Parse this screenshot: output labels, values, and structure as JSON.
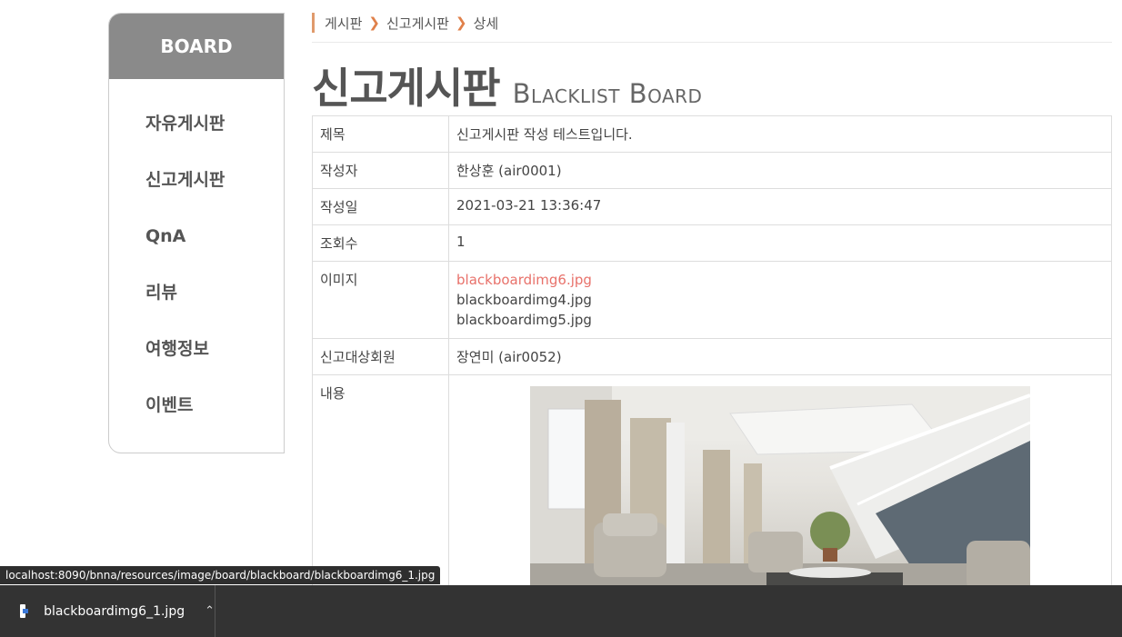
{
  "sidebar": {
    "title": "BOARD",
    "items": [
      "자유게시판",
      "신고게시판",
      "QnA",
      "리뷰",
      "여행정보",
      "이벤트"
    ]
  },
  "breadcrumb": [
    "게시판",
    "신고게시판",
    "상세"
  ],
  "page": {
    "title": "신고게시판",
    "subtitle": "Blacklist Board"
  },
  "detail": {
    "rows": [
      {
        "label": "제목",
        "value": "신고게시판 작성 테스트입니다."
      },
      {
        "label": "작성자",
        "value": "한상훈 (air0001)"
      },
      {
        "label": "작성일",
        "value": "2021-03-21 13:36:47"
      },
      {
        "label": "조회수",
        "value": "1"
      }
    ],
    "images_label": "이미지",
    "images": [
      "blackboardimg6.jpg",
      "blackboardimg4.jpg",
      "blackboardimg5.jpg"
    ],
    "reported_label": "신고대상회원",
    "reported_value": "장연미 (air0052)",
    "content_label": "내용"
  },
  "status_url": "localhost:8090/bnna/resources/image/board/blackboard/blackboardimg6_1.jpg",
  "download": {
    "filename": "blackboardimg6_1.jpg"
  },
  "colors": {
    "accent": "#e8716a",
    "sidebar_head": "#8a8a8a",
    "download_bar": "#333333"
  }
}
